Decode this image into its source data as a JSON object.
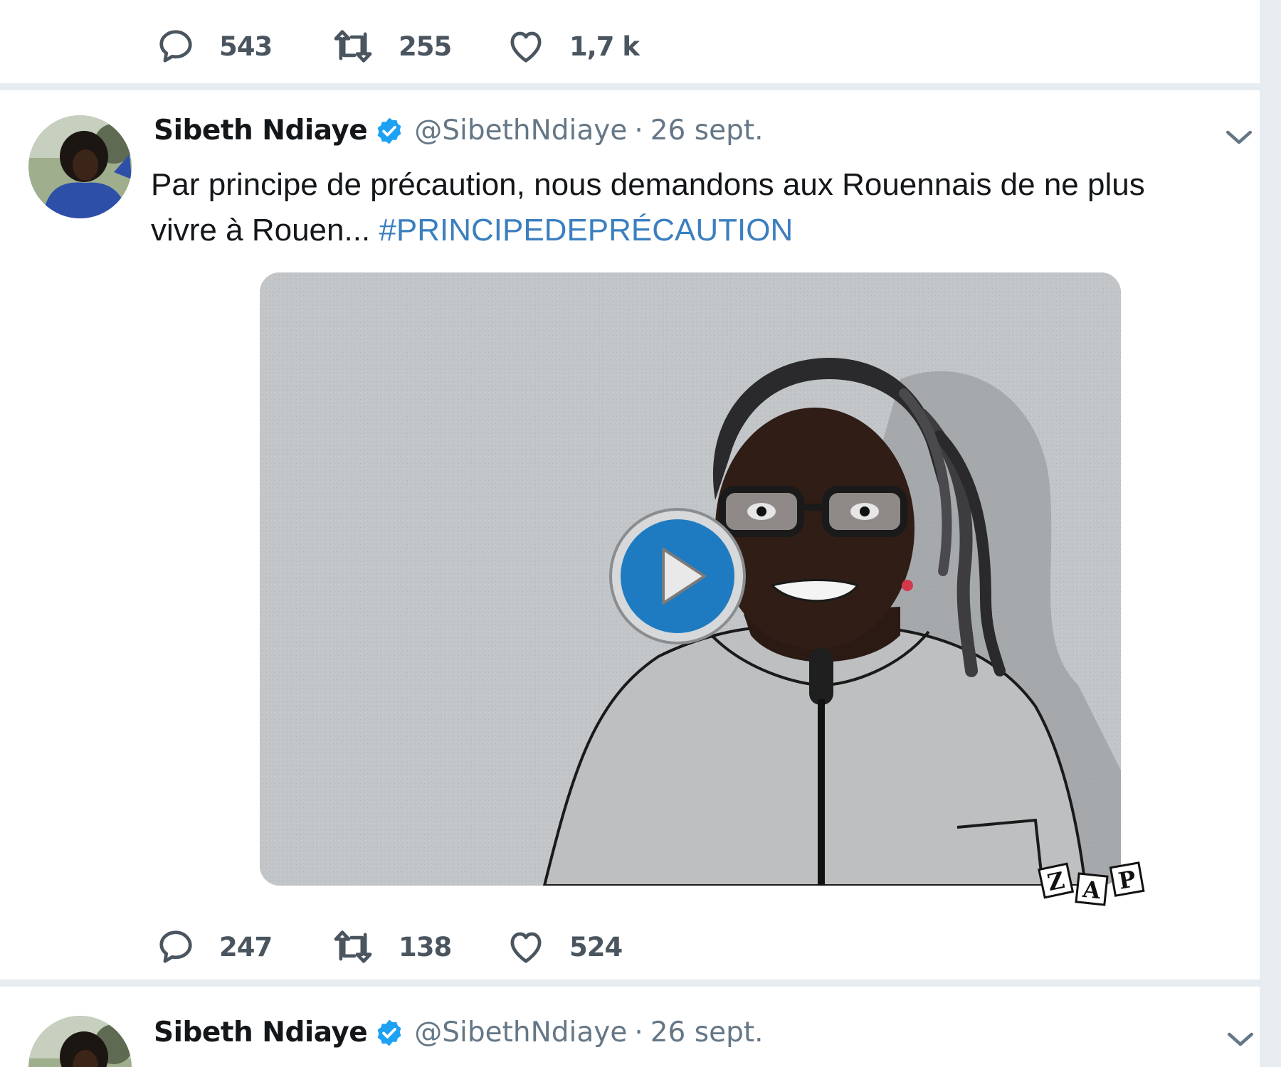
{
  "tweet_top": {
    "actions": {
      "replies": "543",
      "retweets": "255",
      "likes": "1,7 k"
    }
  },
  "tweet_main": {
    "author_name": "Sibeth Ndiaye",
    "handle": "@SibethNdiaye",
    "separator": "·",
    "date": "26 sept.",
    "text": "Par principe de précaution, nous demandons aux Rouennais de ne plus vivre à Rouen... ",
    "hashtag": "#PRINCIPEDEPRÉCAUTION",
    "media": {
      "type": "video",
      "watermark": "ZAP",
      "watermark_letters": [
        "Z",
        "A",
        "P"
      ]
    },
    "actions": {
      "replies": "247",
      "retweets": "138",
      "likes": "524"
    }
  },
  "tweet_next": {
    "author_name": "Sibeth Ndiaye",
    "handle": "@SibethNdiaye",
    "separator": "·",
    "date": "26 sept."
  },
  "icons": {
    "reply": "speech-bubble-icon",
    "retweet": "retweet-arrows-icon",
    "like": "heart-icon",
    "verified": "verified-badge-icon",
    "more": "chevron-down-icon",
    "play": "play-icon"
  },
  "colors": {
    "link": "#3b7fbf",
    "verified": "#1da1f2",
    "play_button": "#1f7bc1",
    "muted": "#657786"
  }
}
